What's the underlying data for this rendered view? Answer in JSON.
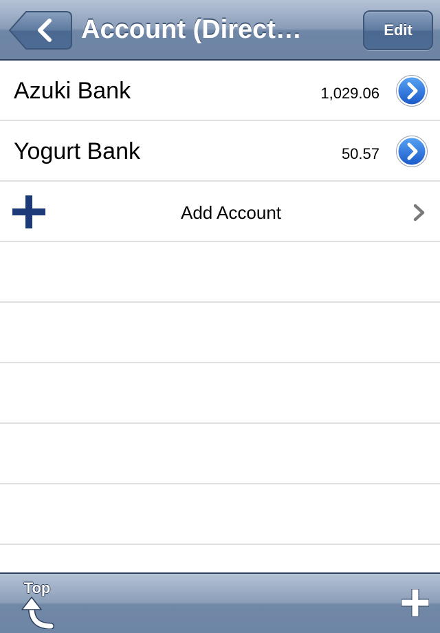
{
  "navbar": {
    "title": "Account (Direct…",
    "back_icon": "chevron-left-icon",
    "edit_label": "Edit"
  },
  "accounts": [
    {
      "name": "Azuki Bank",
      "balance": "1,029.06"
    },
    {
      "name": "Yogurt Bank",
      "balance": "50.57"
    }
  ],
  "add_row": {
    "label": "Add Account",
    "icon": "plus-icon"
  },
  "toolbar": {
    "top_label": "Top",
    "top_icon": "curved-up-arrow-icon",
    "add_icon": "plus-icon"
  },
  "colors": {
    "bar_blue": "#6d84a4",
    "disclosure_blue": "#1f6fd6",
    "plus_navy": "#1c3a78"
  }
}
